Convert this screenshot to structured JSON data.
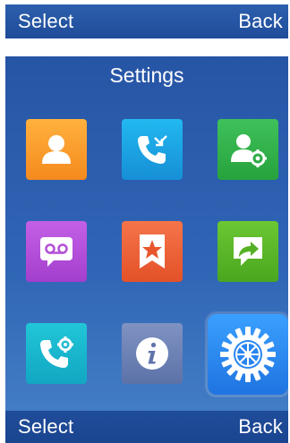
{
  "top_softkeys": {
    "left": "Select",
    "right": "Back"
  },
  "screen": {
    "title": "Settings"
  },
  "tiles": [
    {
      "id": "contacts",
      "icon": "person-icon",
      "color": "#f89a2a"
    },
    {
      "id": "call-history",
      "icon": "phone-arrows-icon",
      "color": "#1aa3e2"
    },
    {
      "id": "contact-settings",
      "icon": "person-gear-icon",
      "color": "#33b04a"
    },
    {
      "id": "voicemail",
      "icon": "voicemail-icon",
      "color": "#b74fdb"
    },
    {
      "id": "favorites",
      "icon": "star-bookmark-icon",
      "color": "#f0623a"
    },
    {
      "id": "intercom",
      "icon": "screen-arrow-icon",
      "color": "#5cb628"
    },
    {
      "id": "call-features",
      "icon": "phone-gear-icon",
      "color": "#1ab7cf"
    },
    {
      "id": "status",
      "icon": "info-icon",
      "color": "#6f83b4"
    },
    {
      "id": "settings",
      "icon": "gear-icon",
      "color": "#2f8af0",
      "selected": true
    }
  ],
  "bottom_softkeys": {
    "left": "Select",
    "right": "Back"
  }
}
